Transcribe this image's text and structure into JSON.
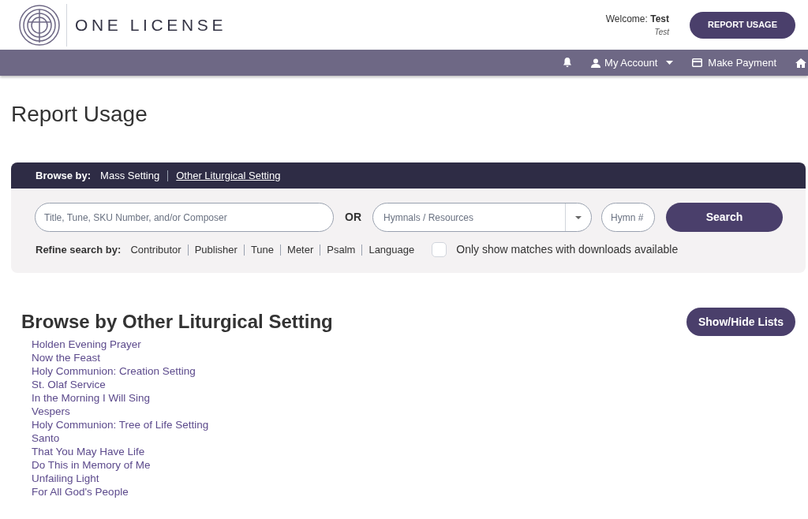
{
  "header": {
    "logo_text": "ONE LICENSE",
    "welcome_label": "Welcome:",
    "welcome_name": "Test",
    "welcome_sub": "Test",
    "report_button": "REPORT USAGE"
  },
  "nav": {
    "items": [
      {
        "kind": "bell"
      },
      {
        "kind": "account",
        "label": "My Account"
      },
      {
        "kind": "payment",
        "label": "Make Payment"
      },
      {
        "kind": "home"
      }
    ]
  },
  "page_title": "Report Usage",
  "browse": {
    "label": "Browse by:",
    "tabs": [
      {
        "label": "Mass Setting",
        "selected": false
      },
      {
        "label": "Other Liturgical Setting",
        "selected": true
      }
    ]
  },
  "search": {
    "query_placeholder": "Title, Tune, SKU Number, and/or Composer",
    "or": "OR",
    "resource_placeholder": "Hymnals / Resources",
    "hymn_placeholder": "Hymn #",
    "button": "Search"
  },
  "refine": {
    "label": "Refine search by:",
    "options": [
      "Contributor",
      "Publisher",
      "Tune",
      "Meter",
      "Psalm",
      "Language"
    ],
    "downloads_only": {
      "label": "Only show matches with downloads available",
      "checked": false
    }
  },
  "section": {
    "title": "Browse by Other Liturgical Setting",
    "toggle_button": "Show/Hide Lists",
    "items": [
      "Holden Evening Prayer",
      "Now the Feast",
      "Holy Communion: Creation Setting",
      "St. Olaf Service",
      "In the Morning I Will Sing",
      "Vespers",
      "Holy Communion: Tree of Life Setting",
      "Santo",
      "That You May Have Life",
      "Do This in Memory of Me",
      "Unfailing Light",
      "For All God's People"
    ]
  }
}
